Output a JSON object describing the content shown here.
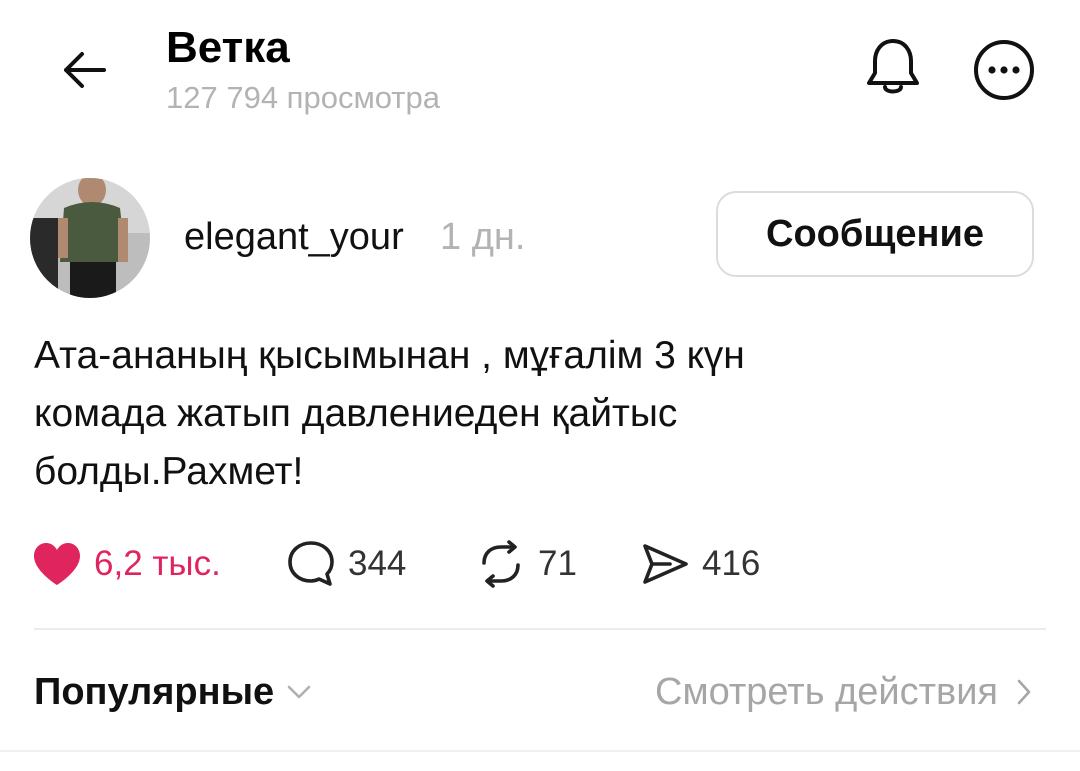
{
  "header": {
    "title": "Ветка",
    "subtitle": "127 794 просмотра",
    "icons": [
      "back-arrow-icon",
      "bell-icon",
      "more-horizontal-icon"
    ]
  },
  "post": {
    "username": "elegant_your",
    "time": "1 дн.",
    "message_button_label": "Сообщение",
    "text": "Ата-ананың қысымынан , мұғалім 3 күн\nкомада жатып давлениеден қайтыс\nболды.Рахмет!",
    "actions": {
      "likes": "6,2 тыс.",
      "comments": "344",
      "reposts": "71",
      "shares": "416"
    }
  },
  "replies_bar": {
    "sort_label": "Популярные",
    "view_activity_label": "Смотреть действия"
  },
  "colors": {
    "like": "#e0245e",
    "muted": "#b3b3b3",
    "text": "#111111"
  }
}
